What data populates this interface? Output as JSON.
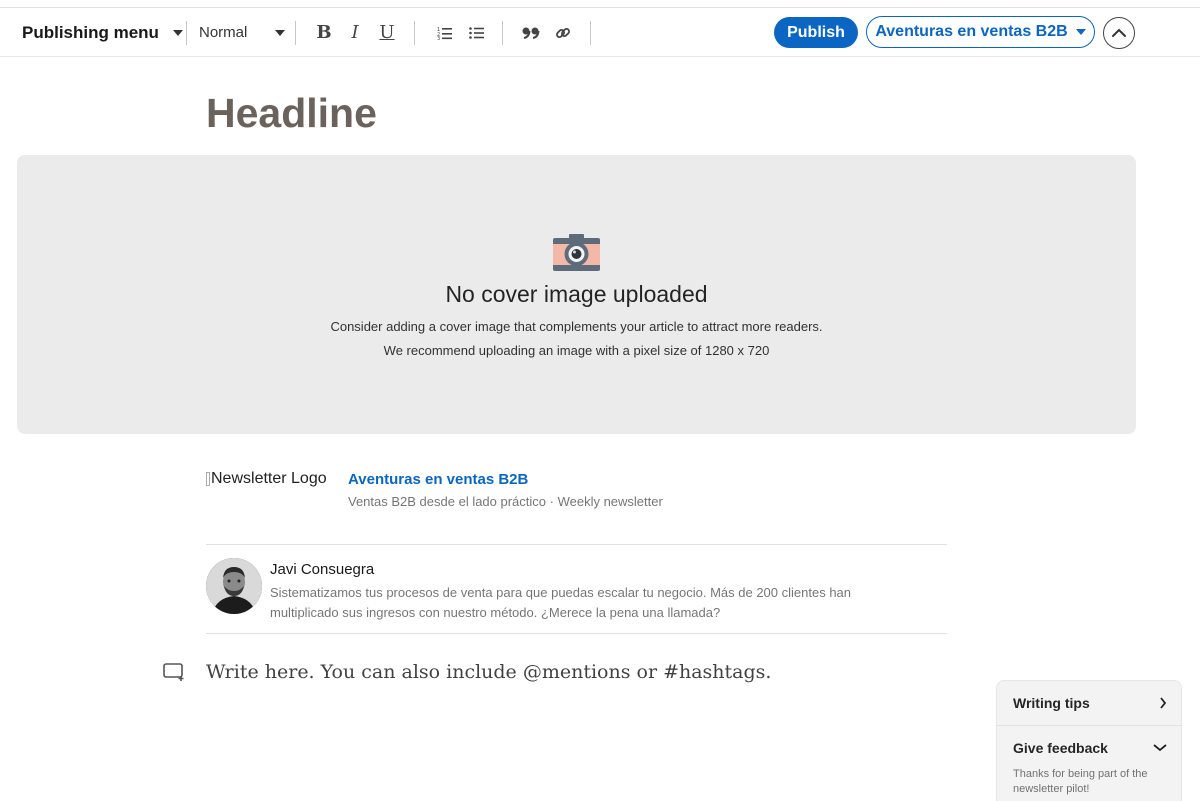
{
  "toolbar": {
    "publishing_menu_label": "Publishing menu",
    "style_select_value": "Normal",
    "bold_label": "B",
    "italic_label": "I",
    "underline_label": "U",
    "publish_label": "Publish",
    "newsletter_select_value": "Aventuras en ventas B2B"
  },
  "article": {
    "headline_placeholder": "Headline",
    "body_placeholder": "Write here. You can also include @mentions or #hashtags."
  },
  "cover": {
    "title": "No cover image uploaded",
    "description_line1": "Consider adding a cover image that complements your article to attract more readers.",
    "description_line2": "We recommend uploading an image with a pixel size of 1280 x 720"
  },
  "newsletter": {
    "logo_alt": "Newsletter Logo",
    "name": "Aventuras en ventas B2B",
    "subtitle": "Ventas B2B desde el lado práctico · Weekly newsletter"
  },
  "author": {
    "name": "Javi Consuegra",
    "bio": "Sistematizamos tus procesos de venta para que puedas escalar tu negocio. Más de 200 clientes han multiplicado sus ingresos con nuestro método. ¿Merece la pena una llamada?"
  },
  "help_panel": {
    "writing_tips_label": "Writing tips",
    "give_feedback_label": "Give feedback",
    "feedback_note": "Thanks for being part of the newsletter pilot!"
  },
  "colors": {
    "brand_blue": "#0a66c2",
    "cover_bg": "#ebebeb",
    "headline_gray": "#6b625c"
  }
}
